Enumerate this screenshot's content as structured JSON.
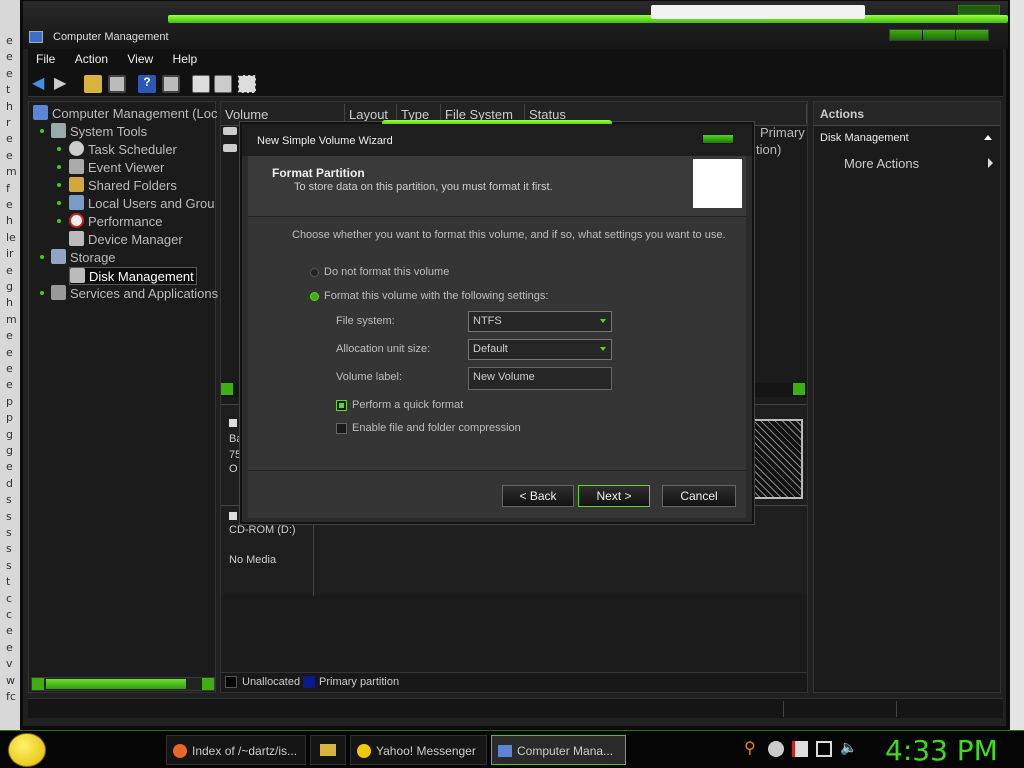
{
  "window": {
    "title": "Computer Management"
  },
  "menu": [
    "File",
    "Action",
    "View",
    "Help"
  ],
  "tree": {
    "root": "Computer Management (Loc",
    "system_tools": "System Tools",
    "task_scheduler": "Task Scheduler",
    "event_viewer": "Event Viewer",
    "shared_folders": "Shared Folders",
    "local_users": "Local Users and Grou",
    "performance": "Performance",
    "device_manager": "Device Manager",
    "storage": "Storage",
    "disk_management": "Disk Management",
    "services": "Services and Applications"
  },
  "columns": [
    "Volume",
    "Layout",
    "Type",
    "File System",
    "Status"
  ],
  "center": {
    "partial_primary": "Primary",
    "partial_tion": "tion)",
    "disk_ba": "Ba",
    "disk_75": "75",
    "disk_o": "O",
    "cdrom": "CD-ROM (D:)",
    "no_media": "No Media",
    "legend_unallocated": "Unallocated",
    "legend_primary": "Primary partition"
  },
  "actions": {
    "header": "Actions",
    "section": "Disk Management",
    "more": "More Actions"
  },
  "wizard": {
    "title": "New Simple Volume Wizard",
    "heading": "Format Partition",
    "subheading": "To store data on this partition, you must format it first.",
    "instruction": "Choose whether you want to format this volume, and if so, what settings you want to use.",
    "radio_no_format": "Do not format this volume",
    "radio_format": "Format this volume with the following settings:",
    "file_system_label": "File system:",
    "file_system_value": "NTFS",
    "alloc_label": "Allocation unit size:",
    "alloc_value": "Default",
    "volume_label_label": "Volume label:",
    "volume_label_value": "New Volume",
    "quick_format": "Perform a quick format",
    "compression": "Enable file and folder compression",
    "back": "< Back",
    "next": "Next >",
    "cancel": "Cancel"
  },
  "taskbar": {
    "firefox": "Index of /~dartz/is...",
    "yahoo": "Yahoo! Messenger",
    "compmgmt": "Computer Mana...",
    "clock": "4:33 PM"
  },
  "left_strip_letters": [
    "e",
    "e",
    "e",
    "t",
    "h",
    "r",
    "e",
    "e",
    "m",
    "f",
    "e",
    "h",
    "le",
    "ir",
    "e",
    "g",
    "h",
    "m",
    "e",
    "e",
    "e",
    "e",
    "p",
    "p",
    "g",
    "g",
    "e",
    "d",
    "s",
    "s",
    "s",
    "s",
    "s",
    "t",
    "c",
    "c",
    "e",
    "e",
    "v",
    "w",
    "fc"
  ],
  "colors": {
    "accent": "#49c81b",
    "accent_bright": "#9eff3d",
    "clock": "#3fdc1a"
  }
}
